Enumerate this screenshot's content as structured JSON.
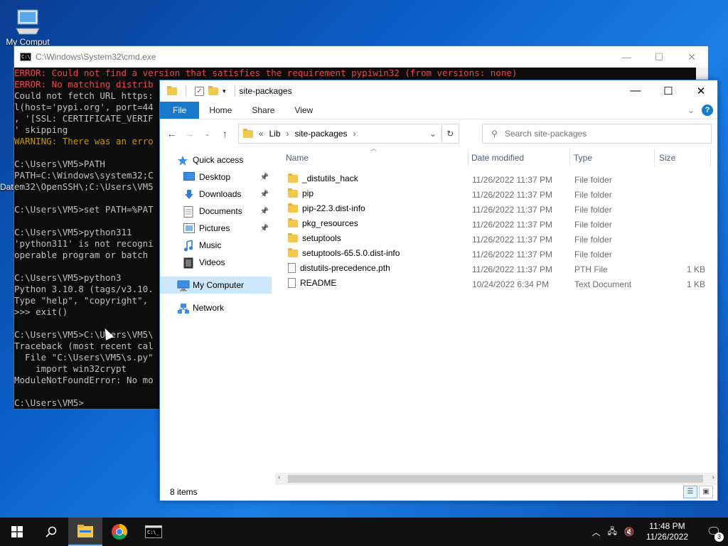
{
  "desktop": {
    "icons": [
      {
        "label": "My Computer",
        "visible_text": "My Comput"
      },
      {
        "label": "Date",
        "visible_text": "Dat"
      }
    ]
  },
  "cmd": {
    "title": "C:\\Windows\\System32\\cmd.exe",
    "controls": {
      "minimize": "—",
      "maximize": "☐",
      "close": "✕"
    },
    "lines": [
      {
        "text": "ERROR: Could not find a version that satisfies the requirement pypiwin32 (from versions: none)",
        "cls": "err"
      },
      {
        "text": "ERROR: No matching distrib",
        "cls": "err"
      },
      {
        "text": "Could not fetch URL https:",
        "cls": ""
      },
      {
        "text": "l(host='pypi.org', port=44",
        "cls": ""
      },
      {
        "text": ", '[SSL: CERTIFICATE_VERIF",
        "cls": ""
      },
      {
        "text": "' skipping",
        "cls": ""
      },
      {
        "text": "WARNING: There was an erro",
        "cls": "warn"
      },
      {
        "text": "",
        "cls": ""
      },
      {
        "text": "C:\\Users\\VM5>PATH",
        "cls": ""
      },
      {
        "text": "PATH=C:\\Windows\\system32;C",
        "cls": ""
      },
      {
        "text": "em32\\OpenSSH\\;C:\\Users\\VM5",
        "cls": ""
      },
      {
        "text": "",
        "cls": ""
      },
      {
        "text": "C:\\Users\\VM5>set PATH=%PAT",
        "cls": ""
      },
      {
        "text": "",
        "cls": ""
      },
      {
        "text": "C:\\Users\\VM5>python311",
        "cls": ""
      },
      {
        "text": "'python311' is not recogni",
        "cls": ""
      },
      {
        "text": "operable program or batch",
        "cls": ""
      },
      {
        "text": "",
        "cls": ""
      },
      {
        "text": "C:\\Users\\VM5>python3",
        "cls": ""
      },
      {
        "text": "Python 3.10.8 (tags/v3.10.",
        "cls": ""
      },
      {
        "text": "Type \"help\", \"copyright\",",
        "cls": ""
      },
      {
        "text": ">>> exit()",
        "cls": ""
      },
      {
        "text": "",
        "cls": ""
      },
      {
        "text": "C:\\Users\\VM5>C:\\Users\\VM5\\",
        "cls": ""
      },
      {
        "text": "Traceback (most recent cal",
        "cls": ""
      },
      {
        "text": "  File \"C:\\Users\\VM5\\s.py\"",
        "cls": ""
      },
      {
        "text": "    import win32crypt",
        "cls": ""
      },
      {
        "text": "ModuleNotFoundError: No mo",
        "cls": ""
      },
      {
        "text": "",
        "cls": ""
      },
      {
        "text": "C:\\Users\\VM5>",
        "cls": ""
      }
    ]
  },
  "explorer": {
    "title": "site-packages",
    "controls": {
      "minimize": "—",
      "maximize": "☐",
      "close": "✕"
    },
    "ribbon": {
      "file": "File",
      "home": "Home",
      "share": "Share",
      "view": "View",
      "help": "?"
    },
    "address": {
      "prefix": "«",
      "parts": [
        "Lib",
        "site-packages"
      ],
      "sep": "›"
    },
    "search_placeholder": "Search site-packages",
    "nav": [
      {
        "label": "Quick access",
        "icon": "star-icon",
        "level": 1,
        "pin": false,
        "sel": false
      },
      {
        "label": "Desktop",
        "icon": "desktop-icon",
        "level": 2,
        "pin": true,
        "sel": false
      },
      {
        "label": "Downloads",
        "icon": "download-icon",
        "level": 2,
        "pin": true,
        "sel": false
      },
      {
        "label": "Documents",
        "icon": "documents-icon",
        "level": 2,
        "pin": true,
        "sel": false
      },
      {
        "label": "Pictures",
        "icon": "pictures-icon",
        "level": 2,
        "pin": true,
        "sel": false
      },
      {
        "label": "Music",
        "icon": "music-icon",
        "level": 2,
        "pin": false,
        "sel": false
      },
      {
        "label": "Videos",
        "icon": "videos-icon",
        "level": 2,
        "pin": false,
        "sel": false
      },
      {
        "label": "My Computer",
        "icon": "computer-icon",
        "level": 1,
        "pin": false,
        "sel": true,
        "gapBefore": true
      },
      {
        "label": "Network",
        "icon": "network-icon",
        "level": 1,
        "pin": false,
        "sel": false,
        "gapBefore": true
      }
    ],
    "columns": {
      "name": "Name",
      "date": "Date modified",
      "type": "Type",
      "size": "Size"
    },
    "files": [
      {
        "name": "_distutils_hack",
        "date": "11/26/2022 11:37 PM",
        "type": "File folder",
        "size": "",
        "kind": "folder"
      },
      {
        "name": "pip",
        "date": "11/26/2022 11:37 PM",
        "type": "File folder",
        "size": "",
        "kind": "folder"
      },
      {
        "name": "pip-22.3.dist-info",
        "date": "11/26/2022 11:37 PM",
        "type": "File folder",
        "size": "",
        "kind": "folder"
      },
      {
        "name": "pkg_resources",
        "date": "11/26/2022 11:37 PM",
        "type": "File folder",
        "size": "",
        "kind": "folder"
      },
      {
        "name": "setuptools",
        "date": "11/26/2022 11:37 PM",
        "type": "File folder",
        "size": "",
        "kind": "folder"
      },
      {
        "name": "setuptools-65.5.0.dist-info",
        "date": "11/26/2022 11:37 PM",
        "type": "File folder",
        "size": "",
        "kind": "folder"
      },
      {
        "name": "distutils-precedence.pth",
        "date": "11/26/2022 11:37 PM",
        "type": "PTH File",
        "size": "1 KB",
        "kind": "file"
      },
      {
        "name": "README",
        "date": "10/24/2022 6:34 PM",
        "type": "Text Document",
        "size": "1 KB",
        "kind": "file"
      }
    ],
    "status": "8 items"
  },
  "taskbar": {
    "time": "11:48 PM",
    "date": "11/26/2022",
    "notifications": "3"
  }
}
